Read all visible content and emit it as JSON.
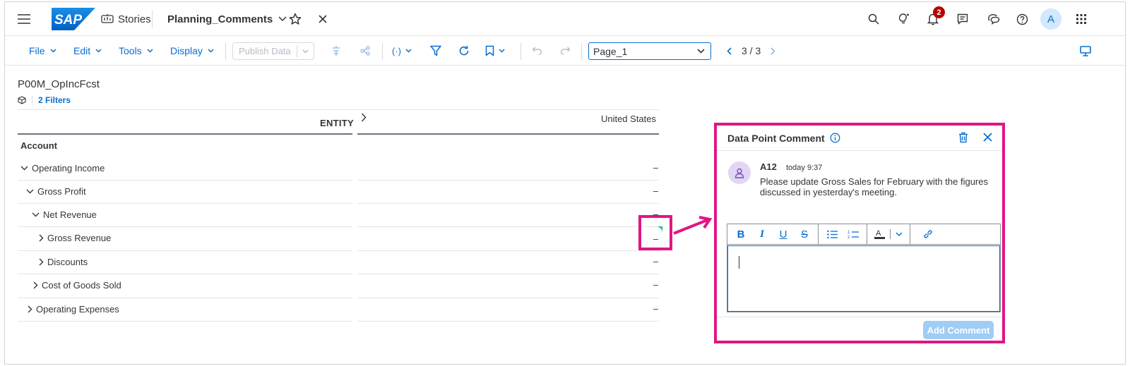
{
  "shell": {
    "logo_text": "SAP",
    "app_name": "Stories",
    "story_title": "Planning_Comments",
    "notification_count": "2",
    "avatar_initial": "A",
    "icons": [
      "menu-icon",
      "stories-icon",
      "chevron-down-icon",
      "star-icon",
      "close-icon",
      "search-icon",
      "ideas-icon",
      "bell-icon",
      "feedback-icon",
      "chat-icon",
      "help-icon",
      "apps-grid-icon"
    ]
  },
  "toolbar": {
    "menus": [
      "File",
      "Edit",
      "Tools",
      "Display"
    ],
    "publish_label": "Publish Data",
    "page_select_value": "Page_1",
    "pager_text": "3 / 3"
  },
  "table": {
    "model_name": "P00M_OpIncFcst",
    "filters_label": "2 Filters",
    "entity_header": "ENTITY",
    "column_header": "United States",
    "account_header": "Account",
    "rows": [
      {
        "label": "Operating Income",
        "value": "–"
      },
      {
        "label": "Gross Profit",
        "value": "–"
      },
      {
        "label": "Net Revenue",
        "value": "–"
      },
      {
        "label": "Gross Revenue",
        "value": "–"
      },
      {
        "label": "Discounts",
        "value": "–"
      },
      {
        "label": "Cost of Goods Sold",
        "value": "–"
      },
      {
        "label": "Operating Expenses",
        "value": "–"
      }
    ]
  },
  "comment_panel": {
    "title": "Data Point Comment",
    "author": "A12",
    "time": "today 9:37",
    "text": "Please update Gross Sales for February with the figures discussed in yesterday's meeting.",
    "add_button": "Add Comment",
    "input_value": ""
  },
  "colors": {
    "accent": "#0a6ed1",
    "highlight": "#e01585",
    "badge": "#bb0000"
  }
}
